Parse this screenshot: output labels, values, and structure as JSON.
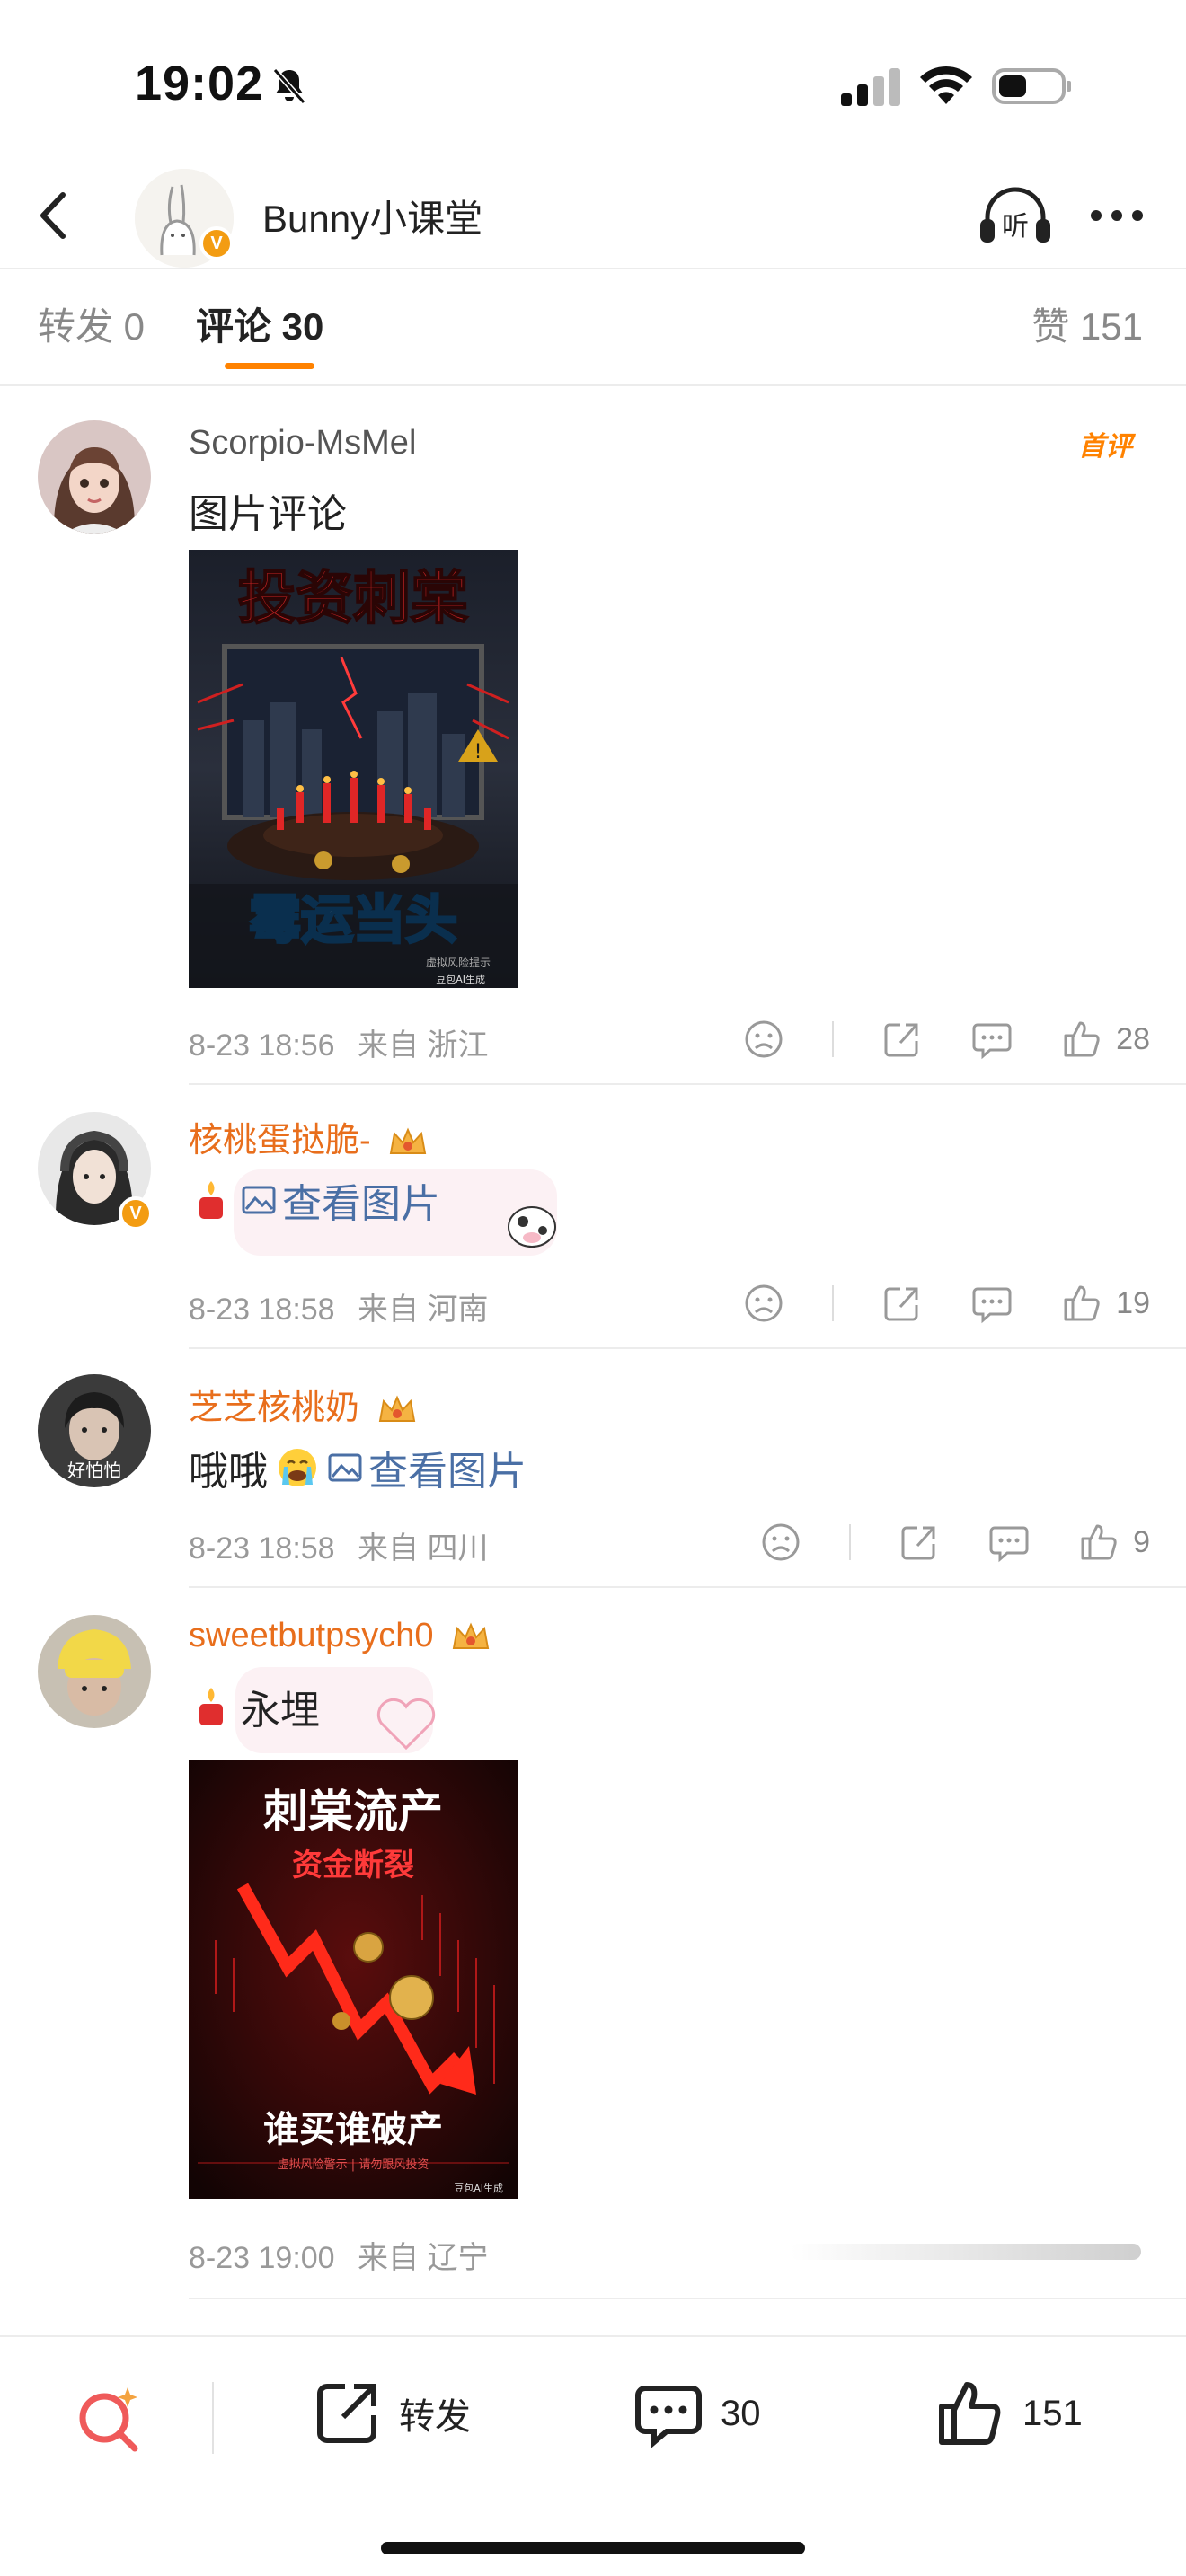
{
  "status_bar": {
    "time": "19:02"
  },
  "header": {
    "title": "Bunny小课堂",
    "listen_label": "听"
  },
  "tabs": {
    "repost": "转发 0",
    "comments": "评论 30",
    "likes": "赞 151"
  },
  "comments": [
    {
      "user": "Scorpio-MsMel",
      "badge": "首评",
      "text": "图片评论",
      "image": {
        "title": "投资刺棠",
        "caption": "霉运当头",
        "small_text": "虚拟风险提示",
        "watermark": "豆包AI生成"
      },
      "time": "8-23 18:56",
      "location": "来自 浙江",
      "likes": "28"
    },
    {
      "user": "核桃蛋挞脆-",
      "text": "查看图片",
      "time": "8-23 18:58",
      "location": "来自 河南",
      "likes": "19"
    },
    {
      "user": "芝芝核桃奶",
      "text_prefix": "哦哦",
      "text": "查看图片",
      "avatar_text": "好怕怕",
      "time": "8-23 18:58",
      "location": "来自 四川",
      "likes": "9"
    },
    {
      "user": "sweetbutpsych0",
      "text": "永埋",
      "image": {
        "title": "刺棠流产",
        "subtitle": "资金断裂",
        "caption": "谁买谁破产",
        "small_text": "虚拟风险警示 | 请勿跟风投资",
        "watermark": "豆包AI生成"
      },
      "time": "8-23 19:00",
      "location": "来自 辽宁"
    }
  ],
  "bottom_bar": {
    "repost_label": "转发",
    "comment_count": "30",
    "like_count": "151"
  },
  "colors": {
    "accent": "#ff8200",
    "username_orange": "#e86e1c",
    "link_blue": "#4a6fa5"
  }
}
